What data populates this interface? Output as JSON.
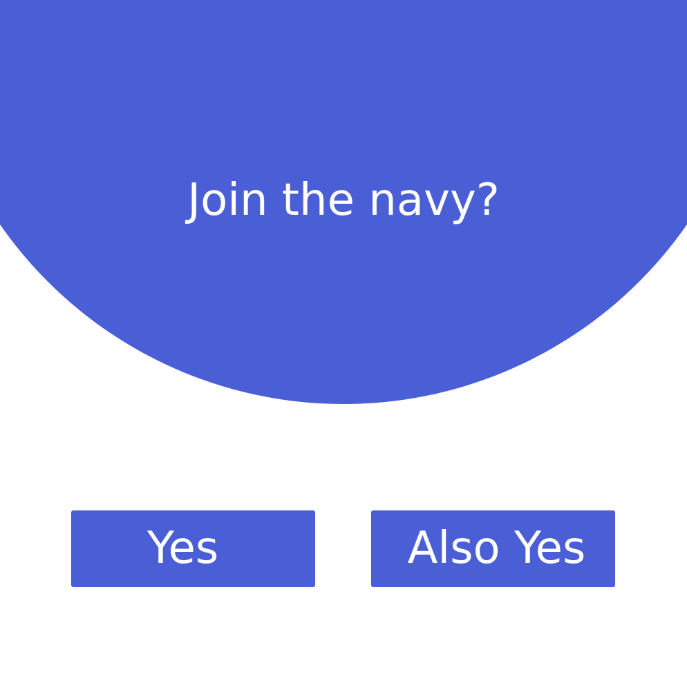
{
  "theme": {
    "accent": "#4A5ED6",
    "background": "#FFFFFF",
    "text_on_accent": "#FFFFFF"
  },
  "prompt": {
    "question": "Join the navy?"
  },
  "buttons": {
    "yes_label": "Yes",
    "also_yes_label": "Also Yes"
  }
}
